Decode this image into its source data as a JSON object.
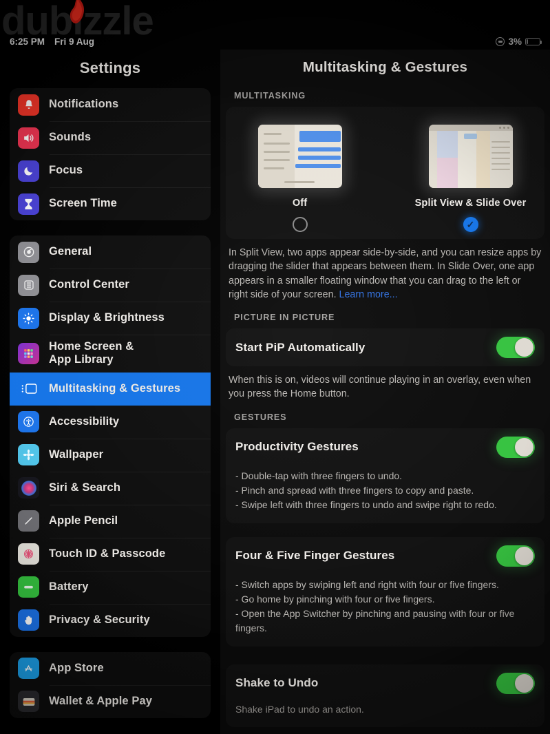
{
  "watermark": {
    "text": "dubizzle"
  },
  "status_bar": {
    "time": "6:25 PM",
    "date": "Fri 9 Aug",
    "battery_percent": "3%"
  },
  "sidebar": {
    "title": "Settings",
    "groups": [
      {
        "items": [
          {
            "label": "Notifications",
            "icon": "bell-icon",
            "color": "#f03427",
            "selected": false
          },
          {
            "label": "Sounds",
            "icon": "speaker-icon",
            "color": "#f03452",
            "selected": false
          },
          {
            "label": "Focus",
            "icon": "moon-icon",
            "color": "#4a42d8",
            "selected": false
          },
          {
            "label": "Screen Time",
            "icon": "hourglass-icon",
            "color": "#4a42d8",
            "selected": false
          }
        ]
      },
      {
        "items": [
          {
            "label": "General",
            "icon": "gear-icon",
            "color": "#8e8e93",
            "selected": false
          },
          {
            "label": "Control Center",
            "icon": "sliders-icon",
            "color": "#8e8e93",
            "selected": false
          },
          {
            "label": "Display & Brightness",
            "icon": "sun-icon",
            "color": "#1b72e8",
            "selected": false
          },
          {
            "label": "Home Screen &\nApp Library",
            "icon": "app-grid-icon",
            "color": "#6a2fd0",
            "selected": false
          },
          {
            "label": "Multitasking & Gestures",
            "icon": "multitasking-icon",
            "color": "#1473e6",
            "selected": true
          },
          {
            "label": "Accessibility",
            "icon": "accessibility-icon",
            "color": "#1b72e8",
            "selected": false
          },
          {
            "label": "Wallpaper",
            "icon": "wallpaper-icon",
            "color": "#4fc3e8",
            "selected": false
          },
          {
            "label": "Siri & Search",
            "icon": "siri-icon",
            "color": "#2a2a36",
            "selected": false
          },
          {
            "label": "Apple Pencil",
            "icon": "pencil-icon",
            "color": "#6e6e73",
            "selected": false
          },
          {
            "label": "Touch ID & Passcode",
            "icon": "fingerprint-icon",
            "color": "#e7e4dd",
            "selected": false
          },
          {
            "label": "Battery",
            "icon": "battery-icon",
            "color": "#35c23f",
            "selected": false
          },
          {
            "label": "Privacy & Security",
            "icon": "hand-icon",
            "color": "#1b72e8",
            "selected": false
          }
        ]
      },
      {
        "items": [
          {
            "label": "App Store",
            "icon": "app-store-icon",
            "color": "#1b9fe8",
            "selected": false
          },
          {
            "label": "Wallet & Apple Pay",
            "icon": "wallet-icon",
            "color": "#2a2a2e",
            "selected": false
          }
        ]
      }
    ]
  },
  "content": {
    "title": "Multitasking & Gestures",
    "multitasking": {
      "section_header": "MULTITASKING",
      "options": [
        {
          "caption": "Off",
          "selected": false
        },
        {
          "caption": "Split View & Slide Over",
          "selected": true
        }
      ],
      "description": "In Split View, two apps appear side-by-side, and you can resize apps by dragging the slider that appears between them. In Slide Over, one app appears in a smaller floating window that you can drag to the left or right side of your screen. ",
      "learn_more": "Learn more..."
    },
    "picture_in_picture": {
      "section_header": "PICTURE IN PICTURE",
      "row_label": "Start PiP Automatically",
      "toggle_on": true,
      "description": "When this is on, videos will continue playing in an overlay, even when you press the Home button."
    },
    "gestures": {
      "section_header": "GESTURES",
      "productivity": {
        "row_label": "Productivity Gestures",
        "toggle_on": true,
        "bullets": [
          "- Double-tap with three fingers to undo.",
          "- Pinch and spread with three fingers to copy and paste.",
          "- Swipe left with three fingers to undo and swipe right to redo."
        ]
      },
      "four_five_finger": {
        "row_label": "Four & Five Finger Gestures",
        "toggle_on": true,
        "bullets": [
          "- Switch apps by swiping left and right with four or five fingers.",
          "- Go home by pinching with four or five fingers.",
          "- Open the App Switcher by pinching and pausing with four or five fingers."
        ]
      },
      "shake_to_undo": {
        "row_label": "Shake to Undo",
        "toggle_on": true,
        "description": "Shake iPad to undo an action."
      }
    }
  },
  "colors": {
    "accent_blue": "#1473e6",
    "toggle_green": "#35c23f",
    "link_blue": "#2f6fe0",
    "text_primary": "#efece8",
    "text_secondary": "#b9b6b2"
  }
}
